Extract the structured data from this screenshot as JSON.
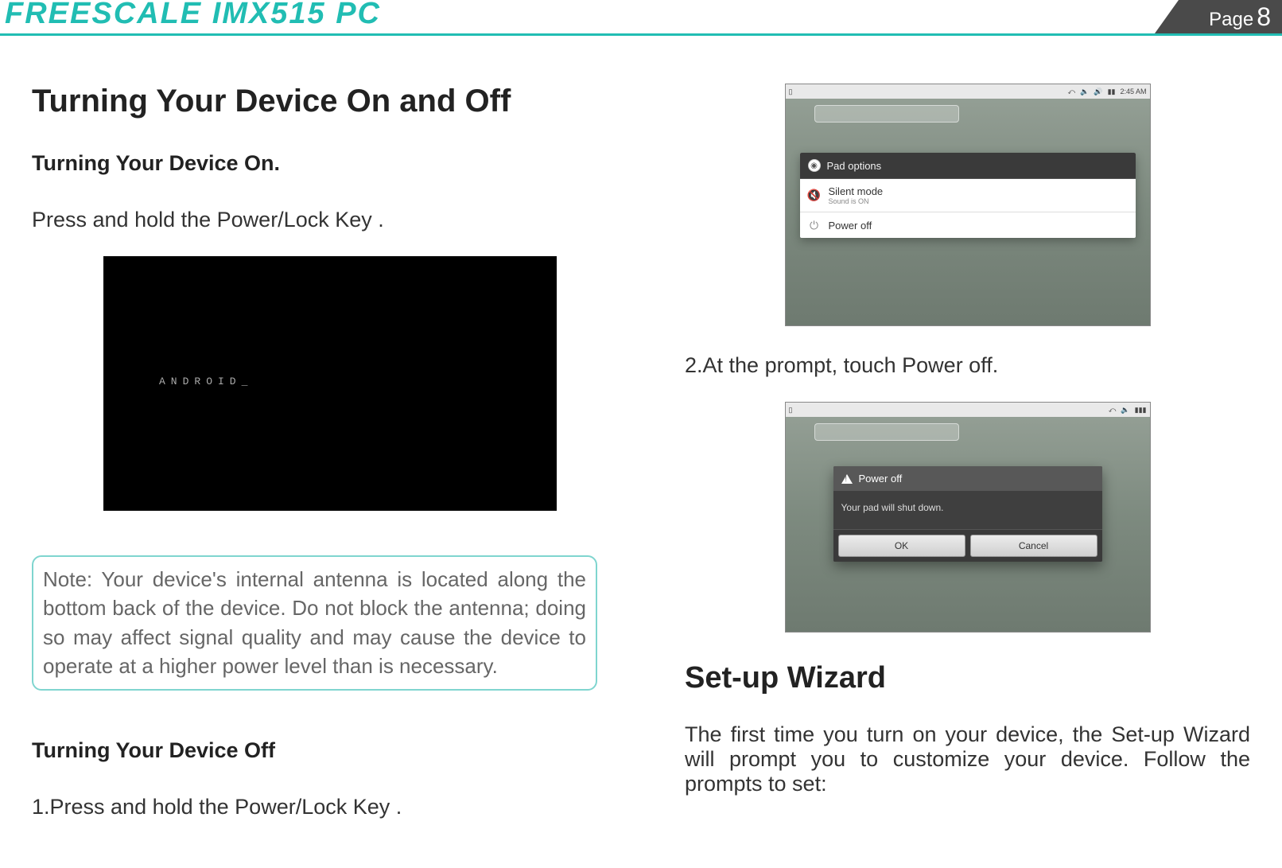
{
  "header": {
    "brand": "FREESCALE  IMX515  PC",
    "page_label": "Page",
    "page_num": "8"
  },
  "left": {
    "title": "Turning Your Device On and Off",
    "on_heading": "Turning Your Device On.",
    "on_body": "Press and hold the Power/Lock Key .",
    "boot_text": "ANDROID_",
    "note": "Note: Your device's internal antenna is located along the bottom back of the device. Do not block the antenna; doing so may affect signal quality and may cause the device to operate at a higher power level than is necessary.",
    "off_heading": "Turning Your Device Off",
    "off_step1": "1.Press and hold the Power/Lock Key ."
  },
  "right": {
    "options_shot": {
      "status_right": "2:45 AM",
      "dialog_title": "Pad options",
      "row1_label": "Silent mode",
      "row1_sub": "Sound is ON",
      "row2_label": "Power off"
    },
    "step2": "2.At the prompt, touch Power off.",
    "confirm_shot": {
      "dialog_title": "Power off",
      "dialog_body": "Your pad will shut down.",
      "ok": "OK",
      "cancel": "Cancel"
    },
    "setup_title": "Set-up Wizard",
    "setup_body": "The first time you turn on your device, the Set-up Wizard will prompt you to customize your device. Follow the prompts to set:"
  }
}
